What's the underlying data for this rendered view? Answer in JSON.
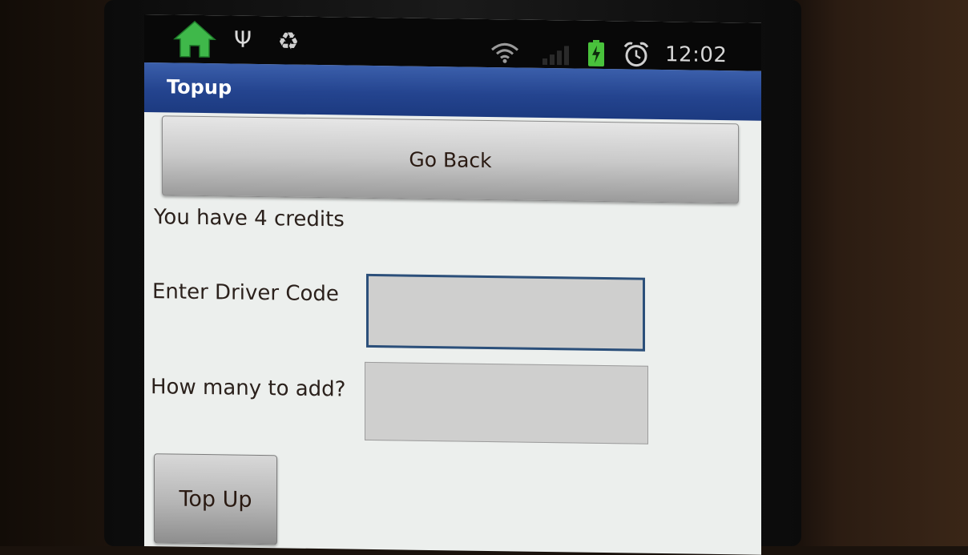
{
  "status_bar": {
    "time": "12:02",
    "icons": [
      "home-icon",
      "usb-icon",
      "recycle-icon",
      "wifi-icon",
      "signal-icon",
      "battery-charging-icon",
      "alarm-icon"
    ],
    "usb_glyph": "Ψ",
    "recycle_glyph": "♻"
  },
  "app": {
    "title": "Topup"
  },
  "main": {
    "go_back_label": "Go Back",
    "credits_text": "You have 4 credits",
    "driver_code_label": "Enter Driver Code",
    "driver_code_value": "",
    "amount_label": "How many to add?",
    "amount_value": "",
    "topup_label": "Top Up"
  },
  "colors": {
    "title_bar": "#24448f",
    "home_icon": "#3fb84a",
    "battery": "#49c23c",
    "focus_border": "#2b4f7a"
  }
}
